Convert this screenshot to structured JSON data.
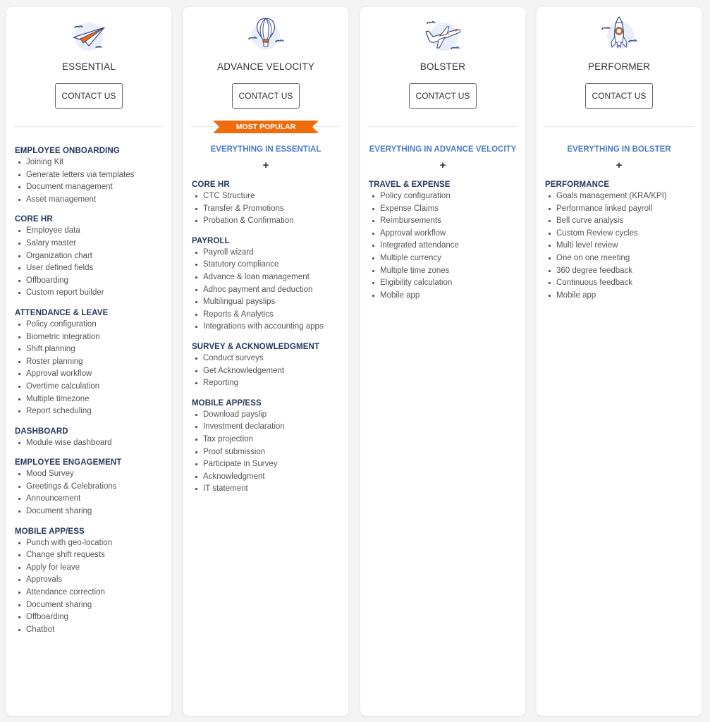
{
  "plans": [
    {
      "name": "ESSENTIAL",
      "icon": "paper-plane-icon",
      "button": "CONTACT US",
      "sections": [
        {
          "title": "EMPLOYEE ONBOARDING",
          "items": [
            "Joining Kit",
            "Generate letters via templates",
            "Document management",
            "Asset management"
          ]
        },
        {
          "title": "CORE HR",
          "items": [
            "Employee data",
            "Salary master",
            "Organization chart",
            "User defined fields",
            "Offboarding",
            "Custom report builder"
          ]
        },
        {
          "title": "ATTENDANCE & LEAVE",
          "items": [
            "Policy configuration",
            "Biometric integration",
            "Shift planning",
            "Roster planning",
            "Approval workflow",
            "Overtime calculation",
            "Multiple timezone",
            "Report scheduling"
          ]
        },
        {
          "title": "DASHBOARD",
          "items": [
            "Module wise dashboard"
          ]
        },
        {
          "title": "EMPLOYEE ENGAGEMENT",
          "items": [
            "Mood Survey",
            "Greetings & Celebrations",
            "Announcement",
            "Document sharing"
          ]
        },
        {
          "title": "MOBILE APP/ESS",
          "items": [
            "Punch with geo-location",
            "Change shift requests",
            "Apply for leave",
            "Approvals",
            "Attendance correction",
            "Document sharing",
            "Offboarding",
            "Chatbot"
          ]
        }
      ]
    },
    {
      "name": "ADVANCE VELOCITY",
      "icon": "hot-air-balloon-icon",
      "button": "CONTACT US",
      "badge": "MOST POPULAR",
      "everything": "EVERYTHING IN ESSENTIAL",
      "plus": "+",
      "sections": [
        {
          "title": "CORE HR",
          "items": [
            "CTC Structure",
            "Transfer & Promotions",
            "Probation & Confirmation"
          ]
        },
        {
          "title": "PAYROLL",
          "items": [
            "Payroll wizard",
            "Statutory compliance",
            "Advance & loan management",
            "Adhoc payment and deduction",
            "Multilingual payslips",
            "Reports & Analytics",
            "Integrations with accounting apps"
          ]
        },
        {
          "title": "SURVEY & ACKNOWLEDGMENT",
          "items": [
            "Conduct surveys",
            "Get Acknowledgement",
            "Reporting"
          ]
        },
        {
          "title": "MOBILE APP/ESS",
          "items": [
            "Download payslip",
            "Investment declaration",
            "Tax projection",
            "Proof submission",
            "Participate in Survey",
            "Acknowledgment",
            "IT statement"
          ]
        }
      ]
    },
    {
      "name": "BOLSTER",
      "icon": "airplane-icon",
      "button": "CONTACT US",
      "everything": "EVERYTHING IN ADVANCE VELOCITY",
      "plus": "+",
      "sections": [
        {
          "title": "TRAVEL & EXPENSE",
          "items": [
            "Policy configuration",
            "Expense Claims",
            "Reimbursements",
            "Approval workflow",
            "Integrated attendance",
            "Multiple currency",
            "Multiple time zones",
            "Eligibility calculation",
            "Mobile app"
          ]
        }
      ]
    },
    {
      "name": "PERFORMER",
      "icon": "rocket-icon",
      "button": "CONTACT US",
      "everything": "EVERYTHING IN BOLSTER",
      "plus": "+",
      "sections": [
        {
          "title": "PERFORMANCE",
          "items": [
            "Goals management (KRA/KPI)",
            "Performance linked payroll",
            "Bell curve analysis",
            "Custom Review cycles",
            "Multi level review",
            "One on one meeting",
            "360 degree feedback",
            "Continuous feedback",
            "Mobile app"
          ]
        }
      ]
    }
  ],
  "colors": {
    "accent_orange": "#ef6c0c",
    "everything_blue": "#4a7ccb",
    "section_navy": "#26365f",
    "icon_stroke": "#3b4a8a",
    "icon_bg": "#e8eefa"
  }
}
